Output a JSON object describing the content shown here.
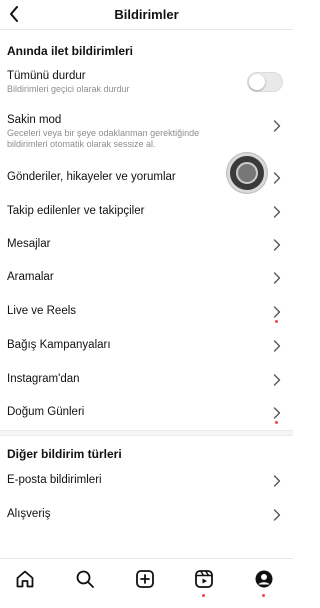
{
  "header": {
    "title": "Bildirimler"
  },
  "section_immediate": {
    "title": "Anında ilet bildirimleri"
  },
  "pause_all": {
    "label": "Tümünü durdur",
    "subtitle": "Bildirimleri geçici olarak durdur",
    "enabled": false
  },
  "quiet_mode": {
    "label": "Sakin mod",
    "subtitle_line1": "Geceleri veya bir şeye odaklanman gerektiğinde",
    "subtitle_line2": "bildirimleri otomatik olarak sessize al."
  },
  "items": [
    {
      "label": "Gönderiler, hikayeler ve yorumlar"
    },
    {
      "label": "Takip edilenler ve takipçiler"
    },
    {
      "label": "Mesajlar"
    },
    {
      "label": "Aramalar"
    },
    {
      "label": "Live ve Reels"
    },
    {
      "label": "Bağış Kampanyaları"
    },
    {
      "label": "Instagram'dan"
    },
    {
      "label": "Doğum Günleri"
    }
  ],
  "section_other": {
    "title": "Diğer bildirim türleri"
  },
  "other_items": [
    {
      "label": "E-posta bildirimleri"
    },
    {
      "label": "Alışveriş"
    }
  ],
  "tabbar": {
    "tabs": [
      {
        "icon": "home-icon"
      },
      {
        "icon": "search-icon"
      },
      {
        "icon": "create-icon"
      },
      {
        "icon": "reels-icon"
      },
      {
        "icon": "profile-icon"
      }
    ]
  },
  "colors": {
    "notification_dot": "#ed4956",
    "secondary_text": "#8e8e8e"
  }
}
